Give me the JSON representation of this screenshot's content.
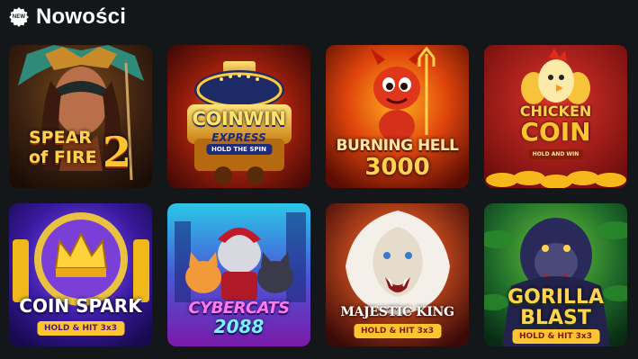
{
  "section": {
    "badge": "NEW",
    "title": "Nowości"
  },
  "games": [
    {
      "line1": "SPEAR",
      "line2": "of FIRE",
      "number": "2"
    },
    {
      "title": "COINWIN",
      "sub": "EXPRESS",
      "sub2": "HOLD THE SPIN"
    },
    {
      "line1": "BURNING HELL",
      "line2": "3000"
    },
    {
      "line1": "CHICKEN",
      "line2": "COIN",
      "sub": "HOLD AND WIN"
    },
    {
      "title": "COIN SPARK",
      "sub": "HOLD & HIT 3x3"
    },
    {
      "line1": "CYBERCATS",
      "line2": "2088"
    },
    {
      "title": "MAJESTIC KING",
      "sub": "HOLD & HIT 3x3"
    },
    {
      "line1": "GORILLA",
      "line2": "BLAST",
      "sub": "HOLD & HIT 3x3"
    }
  ],
  "colors": {
    "background": "#131719",
    "badge": "#ffffff",
    "fire": "#ff6a00",
    "gold": "#ffc531"
  }
}
